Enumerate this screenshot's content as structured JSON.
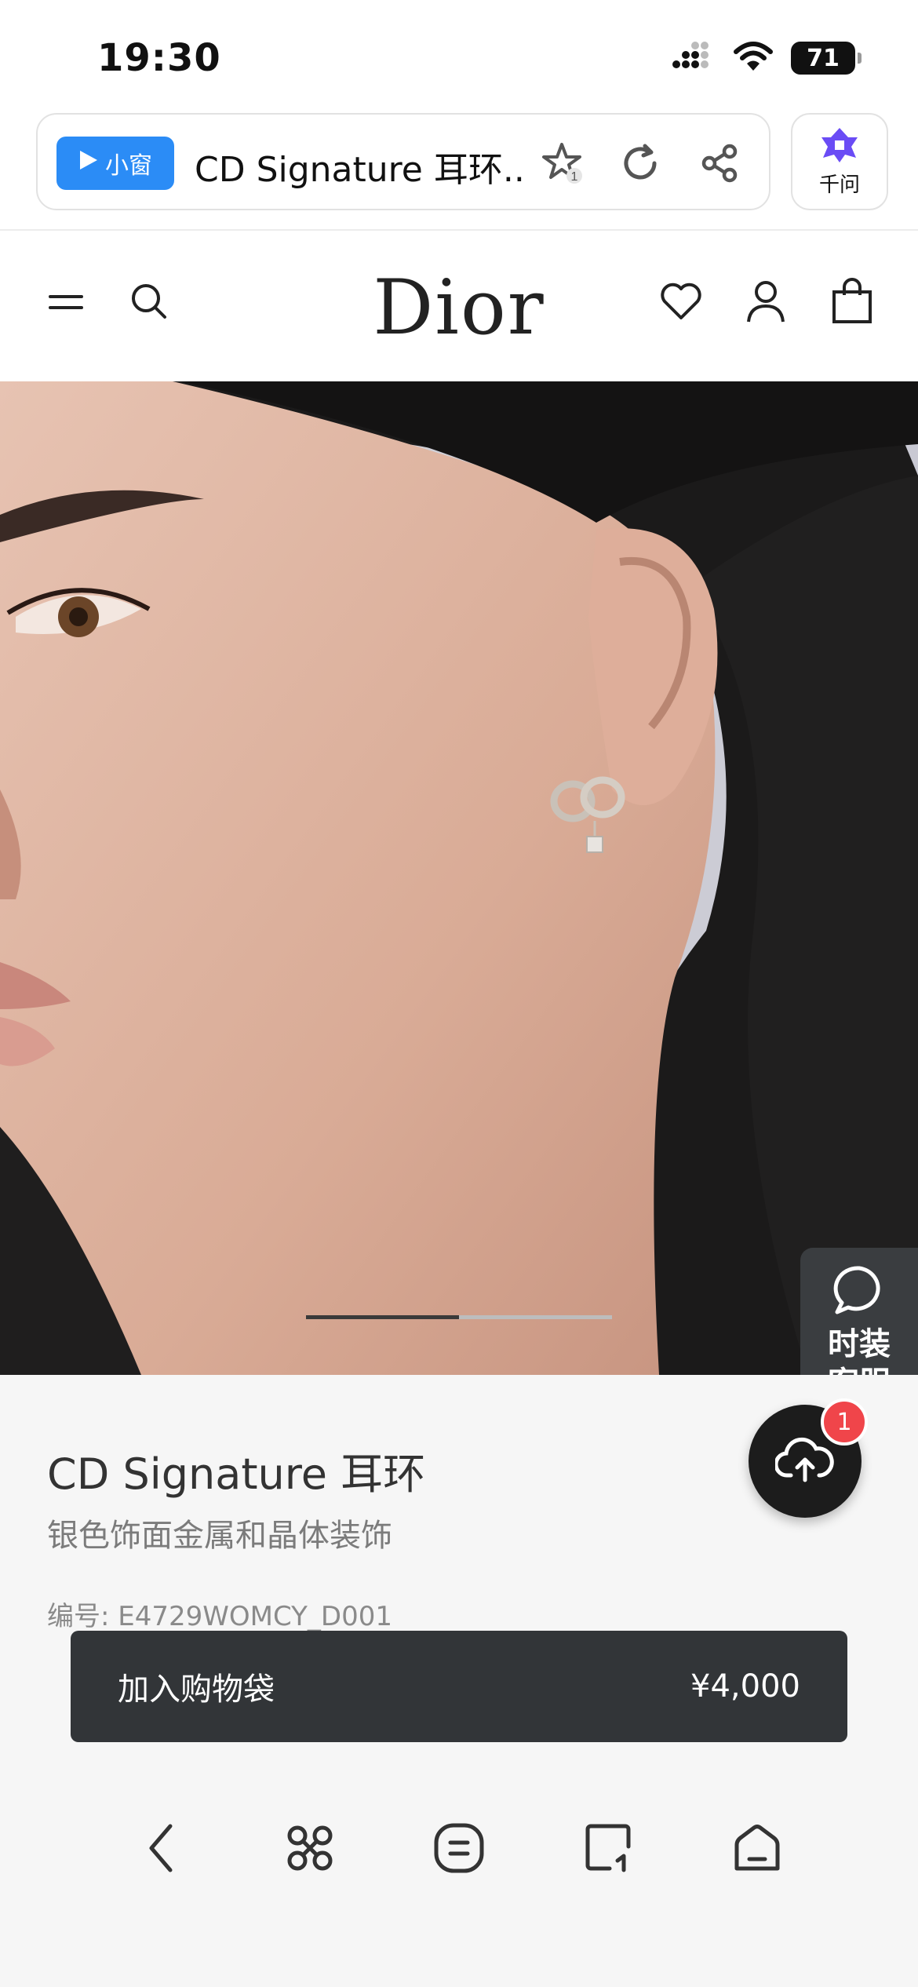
{
  "status_bar": {
    "time": "19:30",
    "battery": "71",
    "icons": [
      "signal-icon",
      "wifi-icon",
      "battery-icon"
    ]
  },
  "browser": {
    "mini_window_label": "小窗",
    "tab_title": "CD Signature 耳环..",
    "favorites_count": "1",
    "assistant_label": "千问",
    "icons": [
      "favorite-star-icon",
      "refresh-icon",
      "share-icon",
      "qianwen-logo-icon"
    ]
  },
  "site_header": {
    "brand": "Dior",
    "icons": [
      "menu-icon",
      "search-icon",
      "heart-icon",
      "account-icon",
      "bag-icon"
    ]
  },
  "carousel": {
    "slide_progress": 0.5
  },
  "chat_widget": {
    "label": "时装客服"
  },
  "upload_fab": {
    "badge": "1"
  },
  "product": {
    "title": "CD Signature 耳环",
    "subtitle": "银色饰面金属和晶体装饰",
    "sku": "编号: E4729WOMCY_D001",
    "add_to_bag_label": "加入购物袋",
    "price": "¥4,000"
  },
  "bottom_nav": {
    "icons": [
      "back-icon",
      "command-icon",
      "menu-list-icon",
      "tabs-icon",
      "home-icon"
    ]
  },
  "colors": {
    "accent_blue": "#2b8cf6",
    "button_dark": "#323538",
    "badge_red": "#f0454a",
    "qianwen_purple": "#6a4cf5"
  }
}
